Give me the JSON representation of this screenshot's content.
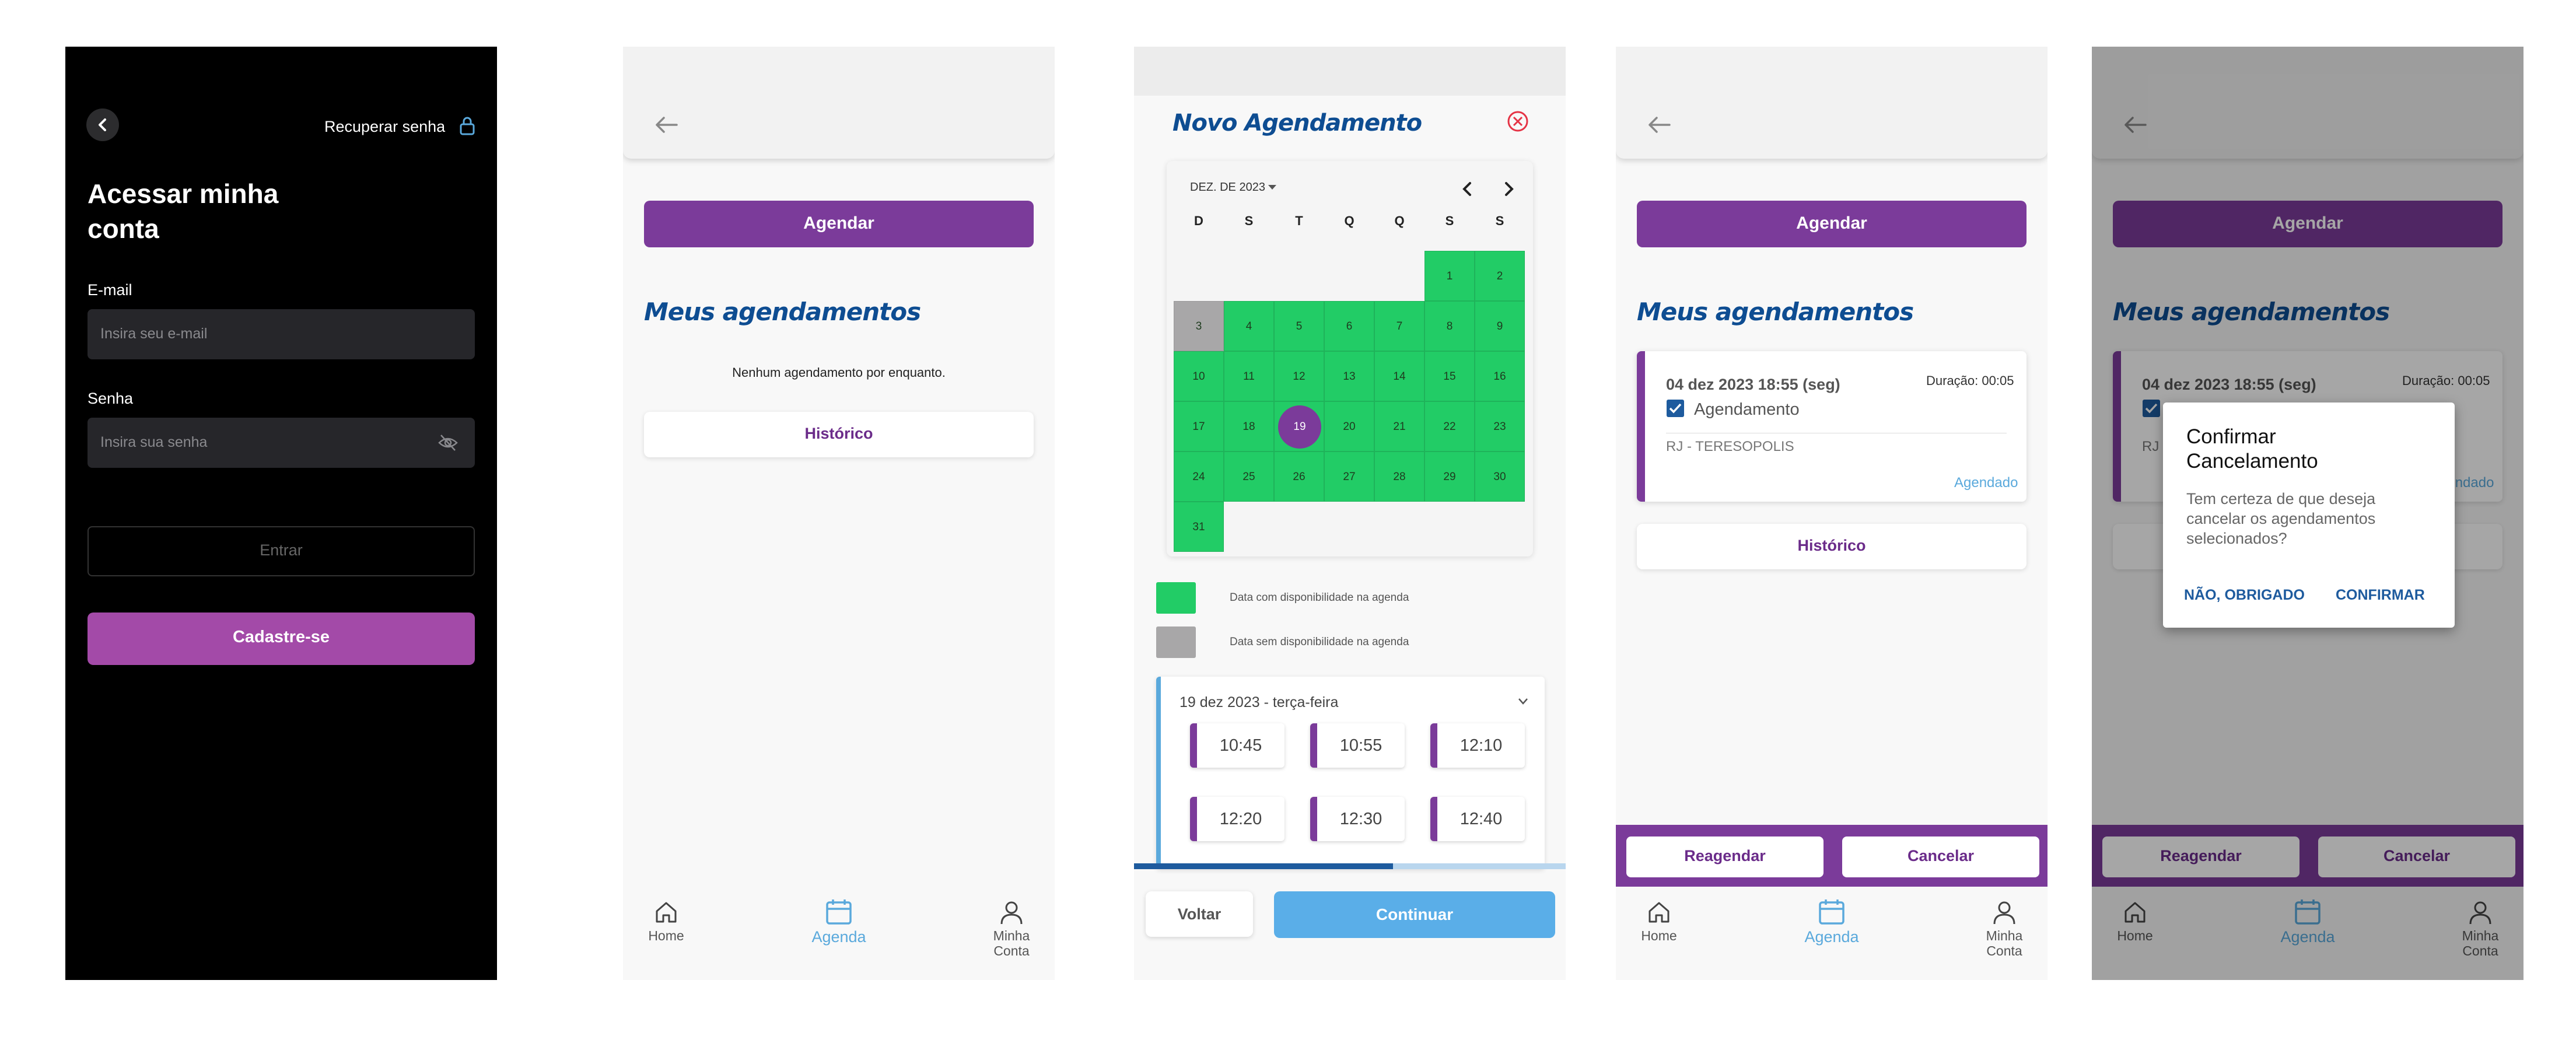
{
  "login": {
    "recover_label": "Recuperar senha",
    "title": "Acessar minha conta",
    "email_label": "E-mail",
    "email_placeholder": "Insira seu e-mail",
    "password_label": "Senha",
    "password_placeholder": "Insira sua senha",
    "enter_label": "Entrar",
    "signup_label": "Cadastre-se"
  },
  "agenda": {
    "schedule_button": "Agendar",
    "section_title": "Meus agendamentos",
    "empty_text": "Nenhum agendamento por enquanto.",
    "history_button": "Histórico"
  },
  "new_booking": {
    "title": "Novo Agendamento",
    "month_label": "DEZ. DE 2023",
    "weekdays": [
      "D",
      "S",
      "T",
      "Q",
      "Q",
      "S",
      "S"
    ],
    "days": [
      "1",
      "2",
      "3",
      "4",
      "5",
      "6",
      "7",
      "8",
      "9",
      "10",
      "11",
      "12",
      "13",
      "14",
      "15",
      "16",
      "17",
      "18",
      "19",
      "20",
      "21",
      "22",
      "23",
      "24",
      "25",
      "26",
      "27",
      "28",
      "29",
      "30",
      "31"
    ],
    "selected_day": "19",
    "unavailable_day": "3",
    "legend_available": "Data com disponibilidade na agenda",
    "legend_unavailable": "Data sem disponibilidade na agenda",
    "slot_date": "19 dez 2023 - terça-feira",
    "slots": [
      "10:45",
      "10:55",
      "12:10",
      "12:20",
      "12:30",
      "12:40"
    ],
    "progress": 0.6,
    "back_button": "Voltar",
    "continue_button": "Continuar"
  },
  "appointment": {
    "datetime": "04 dez 2023 18:55 (seg)",
    "duration": "Duração: 00:05",
    "type": "Agendamento",
    "location": "RJ - TERESOPOLIS",
    "status": "Agendado",
    "checked": true,
    "reschedule_button": "Reagendar",
    "cancel_button": "Cancelar"
  },
  "dialog": {
    "title": "Confirmar Cancelamento",
    "message": "Tem certeza de que deseja cancelar os agendamentos selecionados?",
    "no_button": "NÃO, OBRIGADO",
    "confirm_button": "CONFIRMAR"
  },
  "nav": {
    "home": "Home",
    "agenda": "Agenda",
    "account": "Minha Conta"
  },
  "colors": {
    "purple": "#7b3b9a",
    "signup_purple": "#a34aa8",
    "blue_title": "#0e4d92",
    "accent_blue": "#5aa9dc",
    "available_green": "#22cc66",
    "unavailable_gray": "#a8a7a8",
    "close_red": "#e53345"
  },
  "icons": [
    "chevron-left-icon",
    "lock-icon",
    "eye-off-icon",
    "arrow-left-icon",
    "close-circle-icon",
    "chevron-down-icon",
    "caret-down-icon",
    "chevron-right-icon",
    "home-icon",
    "calendar-icon",
    "user-icon",
    "checkbox-icon"
  ]
}
